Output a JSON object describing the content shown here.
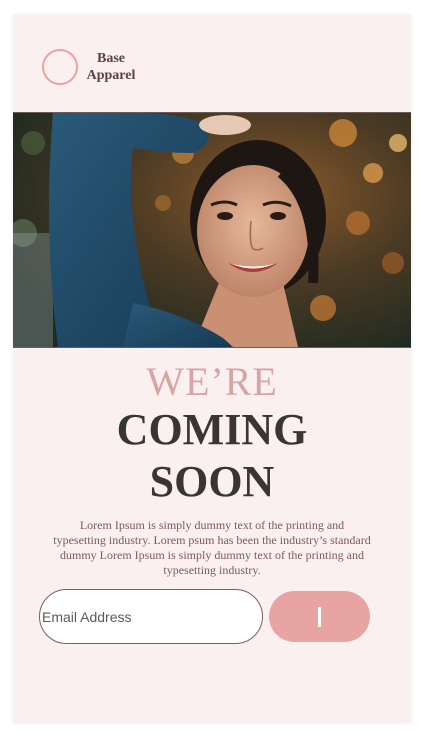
{
  "brand": {
    "line1": "Base",
    "line2": "Apparel",
    "logo_icon": "circle-logo-icon"
  },
  "hero": {
    "alt": "woman-portrait-photo"
  },
  "headline": {
    "line1": "WE’RE",
    "line2": "COMING",
    "line3": "SOON"
  },
  "description": "Lorem Ipsum is simply dummy text of the printing and typesetting industry. Lorem psum has been the industry’s standard dummy Lorem Ipsum is simply dummy text of the printing and typesetting industry.",
  "form": {
    "email_placeholder": "Email Address",
    "email_value": "",
    "submit_icon": "cursor-bar-icon"
  },
  "colors": {
    "accent": "#e8a3a3",
    "soft_accent": "#d7a4a4",
    "background": "#fbf0f0",
    "dark_text": "#3a3535",
    "body_text": "#7b5a5a"
  }
}
